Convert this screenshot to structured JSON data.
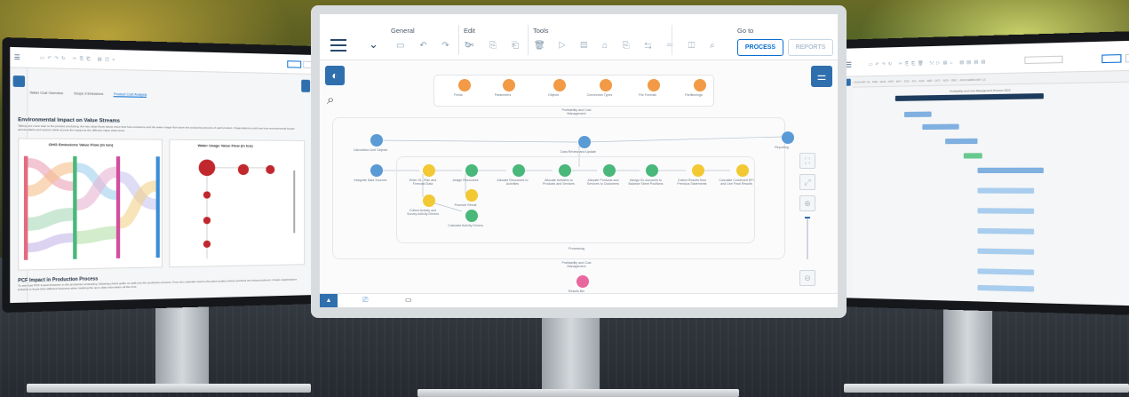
{
  "center": {
    "toolbar": {
      "groups": [
        {
          "title": "General",
          "icons": "▭ ↶ ↷ ↻"
        },
        {
          "title": "Edit",
          "icons": "✂ ⎘ ⎗ 🗑"
        },
        {
          "title": "Tools",
          "icons": "⤲ ▷ ▤ ⌂ ⎘ ⇆ ⚌ ◫ ⌕"
        }
      ],
      "goto_title": "Go to",
      "process_label": "PROCESS",
      "reports_label": "REPORTS"
    },
    "top_band_nodes": [
      {
        "label": "Fields",
        "color": "#f29a45"
      },
      {
        "label": "Parameters",
        "color": "#f29a45"
      },
      {
        "label": "Objects",
        "color": "#f29a45"
      },
      {
        "label": "Conversion Types",
        "color": "#f29a45"
      },
      {
        "label": "File Formats",
        "color": "#f29a45"
      },
      {
        "label": "Partitionings",
        "color": "#f29a45"
      }
    ],
    "profitability_label": "Profitability and Cost Management",
    "flow_nodes": [
      {
        "label": "Calculation Unit Objects",
        "color": "#5a9bd6"
      },
      {
        "label": "Integrate Data Sources",
        "color": "#5a9bd6"
      },
      {
        "label": "Enter GL, Plan and Forecast Data",
        "color": "#f2c933"
      },
      {
        "label": "Collect Activity and Survey Activity Drivers",
        "color": "#f2c933"
      },
      {
        "label": "Assign Resources",
        "color": "#49b87a"
      },
      {
        "label": "Promote Result",
        "color": "#f2c933"
      },
      {
        "label": "Calculate Activity Drivers",
        "color": "#49b87a"
      },
      {
        "label": "Allocate Resources to Activities",
        "color": "#49b87a"
      },
      {
        "label": "Allocate Activities to Products and Services",
        "color": "#49b87a"
      },
      {
        "label": "Allocate Products and Services to Customers",
        "color": "#49b87a"
      },
      {
        "label": "Assign GL Accounts to Balance Sheet Positions",
        "color": "#49b87a"
      },
      {
        "label": "Collect Results from Previous Statements",
        "color": "#f2c933"
      },
      {
        "label": "Calculate Combined KPI and Line Final Results",
        "color": "#f2c933"
      },
      {
        "label": "Data Review and Update",
        "color": "#5a9bd6"
      },
      {
        "label": "Reporting",
        "color": "#5a9bd6"
      }
    ],
    "processing_label": "Processing",
    "profitability_label_2": "Profitability and Cost Management",
    "results_label": "Results Bin"
  },
  "left": {
    "tabs": [
      "Water Cost Overview",
      "Scope 3 Emissions",
      "Product Cost Analysis"
    ],
    "title": "Environmental Impact on Value Streams",
    "paragraph": "Taking one more step to the product producing, the two value flows below show that how emissions and the water usage flow down the producing process of each product. Organizations could see how environmental impact across plants and sectors while access the impact at the different value chain level.",
    "panel1_title": "GHG Emissions Value Flow (in ton)",
    "panel2_title": "Water Usage Value Flow (in ton)",
    "section_title": "PCF Impact in Production Process",
    "section_paragraph": "To see how PCF impact between in the production producing, following charts guide us walk into the production process. From the materials used to the plant location where products are being produced, it helps organizations pinpoint to know their different business when tracking the up to date information all the time."
  },
  "right": {
    "timeline_text": "2023 JANUARY 16 · FEB · MAR · APR · MAY · JUN · JUL · AUG · SEP · OCT · NOV · DEC · 2023 FEBRUARY 13",
    "gantt_title": "Profitability and Cost Management Process 2023"
  },
  "colors": {
    "accent": "#2f6fae",
    "primary_button": "#0a6ed1",
    "orange": "#f29a45",
    "green": "#49b87a",
    "yellow": "#f2c933",
    "blue": "#5a9bd6",
    "pink": "#e9679f"
  }
}
